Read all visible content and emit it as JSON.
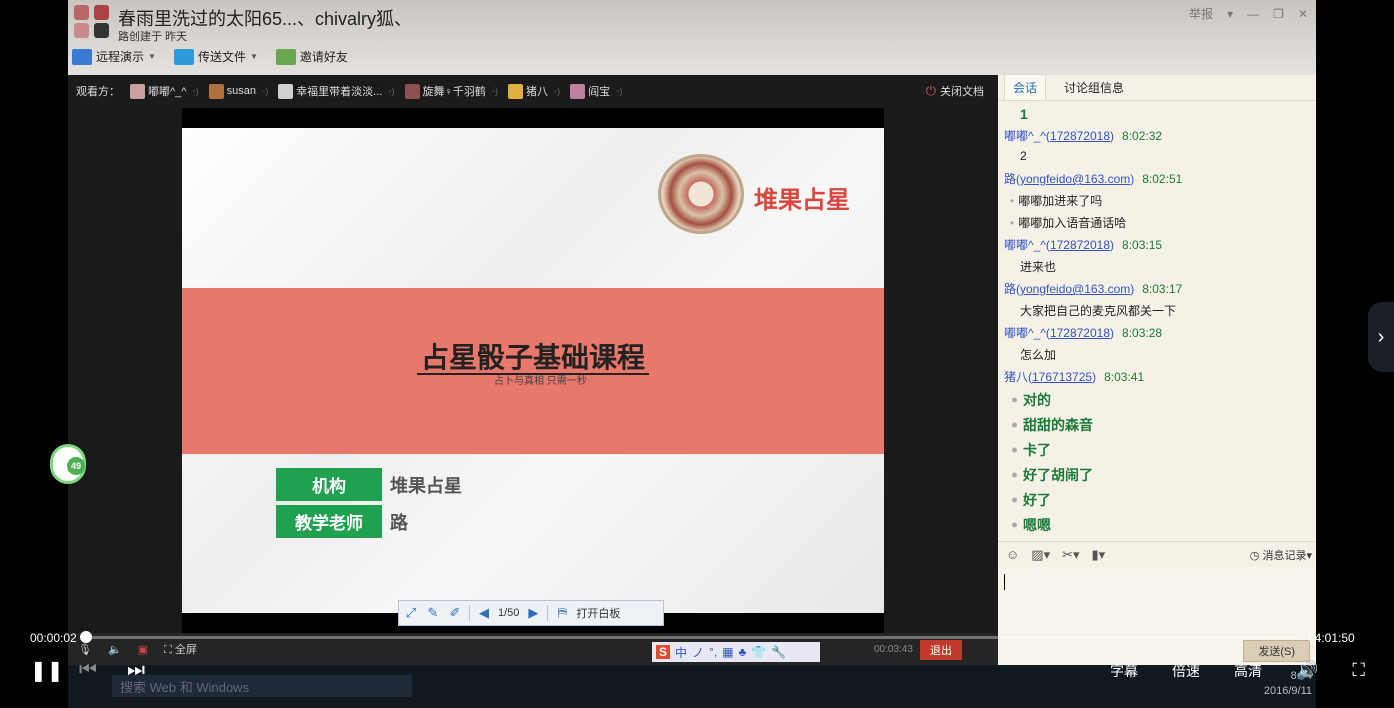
{
  "window": {
    "title": "春雨里洗过的太阳65...、chivalry狐、",
    "subtitle": "路创建于 昨天",
    "controls": [
      "举报",
      "▾",
      "—",
      "❐",
      "✕"
    ]
  },
  "toolbar": [
    {
      "label": "远程演示",
      "color": "#3a7bd5"
    },
    {
      "label": "传送文件",
      "color": "#2f9ad8"
    },
    {
      "label": "邀请好友",
      "color": "#6aa84f"
    }
  ],
  "viewers": {
    "label": "观看方：",
    "list": [
      {
        "name": "嘟嘟^_^",
        "color": "#c9a0a0"
      },
      {
        "name": "susan",
        "color": "#b07040"
      },
      {
        "name": "幸福里带着淡淡...",
        "color": "#d0d0d0"
      },
      {
        "name": "旋舞♀千羽鹤",
        "color": "#905050"
      },
      {
        "name": "猪八",
        "color": "#e0b040"
      },
      {
        "name": "阎宝",
        "color": "#c080a0"
      }
    ],
    "close_doc": "关闭文档"
  },
  "slide": {
    "brand": "堆果占星",
    "title": "占星骰子基础课程",
    "subtitle": "占卜与真相 只需一秒",
    "rows": [
      {
        "label": "机构",
        "value": "堆果占星"
      },
      {
        "label": "教学老师",
        "value": "路"
      }
    ]
  },
  "slide_controls": {
    "page": "1/50",
    "whiteboard": "打开白板"
  },
  "chat": {
    "tabs": [
      "会话",
      "讨论组信息"
    ],
    "active_tab": 0,
    "messages": [
      {
        "type": "body",
        "text": "1",
        "green": false,
        "bold": true
      },
      {
        "type": "head",
        "name": "嘟嘟^_^(",
        "id": "172872018",
        "end": ")",
        "time": "8:02:32"
      },
      {
        "type": "body",
        "text": "2",
        "green": false
      },
      {
        "type": "head",
        "name": "路(",
        "id": "yongfeido@163.com",
        "end": ")",
        "time": "8:02:51"
      },
      {
        "type": "body",
        "text": "嘟嘟加进来了吗",
        "green": false,
        "bullet": true
      },
      {
        "type": "body",
        "text": "嘟嘟加入语音通话哈",
        "green": false,
        "bullet": true
      },
      {
        "type": "head",
        "name": "嘟嘟^_^(",
        "id": "172872018",
        "end": ")",
        "time": "8:03:15"
      },
      {
        "type": "body",
        "text": "进来也",
        "green": false
      },
      {
        "type": "head",
        "name": "路(",
        "id": "yongfeido@163.com",
        "end": ")",
        "time": "8:03:17"
      },
      {
        "type": "body",
        "text": "大家把自己的麦克风都关一下",
        "green": false
      },
      {
        "type": "head",
        "name": "嘟嘟^_^(",
        "id": "172872018",
        "end": ")",
        "time": "8:03:28"
      },
      {
        "type": "body",
        "text": "怎么加",
        "green": false
      },
      {
        "type": "head",
        "name": "猪八(",
        "id": "176713725",
        "end": ")",
        "time": "8:03:41"
      },
      {
        "type": "body",
        "text": "对的",
        "green": true,
        "bullet": true
      },
      {
        "type": "body",
        "text": "甜甜的森音",
        "green": true,
        "bullet": true
      },
      {
        "type": "body",
        "text": "卡了",
        "green": true,
        "bullet": true
      },
      {
        "type": "body",
        "text": "好了胡闹了",
        "green": true,
        "bullet": true
      },
      {
        "type": "body",
        "text": "好了",
        "green": true,
        "bullet": true
      },
      {
        "type": "body",
        "text": "嗯嗯",
        "green": true,
        "bullet": true
      }
    ],
    "message_record": "消息记录",
    "send": "发送(S)"
  },
  "call_strip": {
    "fullscreen": "全屏",
    "ime": [
      "S",
      "中",
      "ノ",
      "°,",
      "▦",
      "♣",
      "👕",
      "🔧"
    ],
    "duration": "00:03:43",
    "exit": "退出"
  },
  "taskbar": {
    "search": "搜索 Web 和 Windows",
    "time": "8:04",
    "date": "2016/9/11"
  },
  "player": {
    "current": "00:00:02",
    "total": "04:01:50",
    "progress_fraction": 0.0001,
    "right_labels": [
      "字幕",
      "倍速",
      "高清"
    ]
  },
  "float_badge": "49"
}
